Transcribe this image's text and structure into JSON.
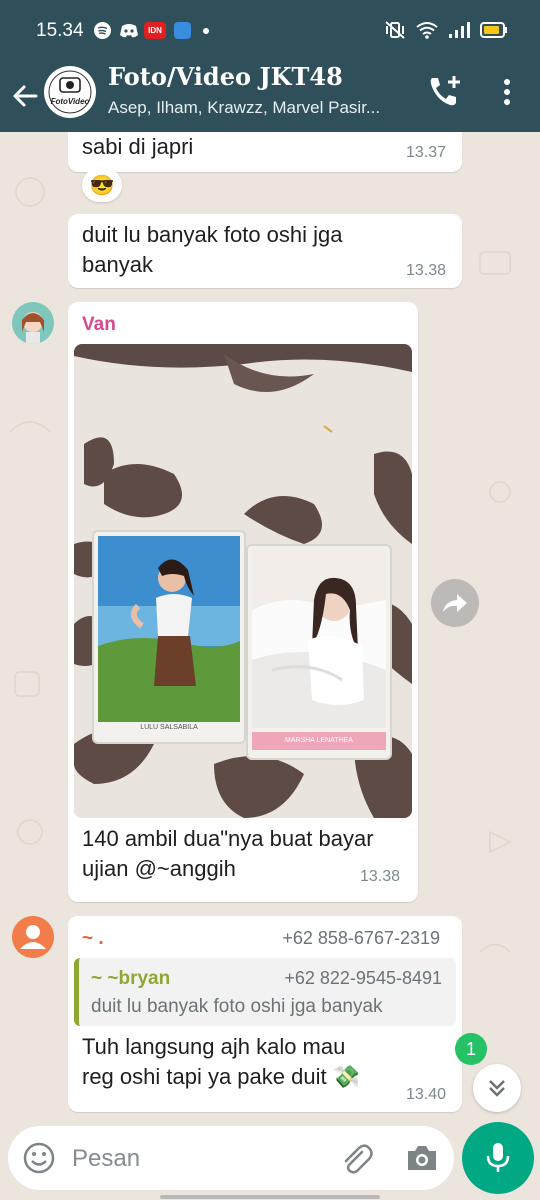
{
  "status_bar": {
    "time": "15.34",
    "app_icons": [
      "spotify-icon",
      "discord-icon",
      "idn-icon",
      "app-icon"
    ],
    "idn_label": "IDN"
  },
  "header": {
    "title": "Foto/Video JKT48",
    "subtitle": "Asep, Ilham, Krawzz, Marvel Pasir...",
    "avatar_text": "FotoVideo",
    "colors": {
      "bar": "#2f4f5a"
    }
  },
  "messages": [
    {
      "text": "sabi di japri",
      "time": "13.37",
      "reaction": "😎"
    },
    {
      "text": "duit lu banyak foto oshi jga banyak",
      "time": "13.38"
    },
    {
      "sender": "Van",
      "sender_color": "#d8488f",
      "image_cards": [
        "LULU SALSABILA",
        "MARSHA LENATHEA"
      ],
      "text": "140 ambil dua\"nya buat bayar ujian @~anggih",
      "time": "13.38"
    },
    {
      "sender": "~ .",
      "sender_color": "#e8622d",
      "phone": "+62 858-6767-2319",
      "quote": {
        "sender": "~ ~bryan",
        "sender_color": "#8ea832",
        "phone": "+62 822-9545-8491",
        "text": "duit lu banyak foto oshi jga banyak"
      },
      "text": "Tuh langsung ajh kalo mau reg oshi tapi ya pake duit",
      "emoji": "💸",
      "time": "13.40"
    }
  ],
  "unread_count": "1",
  "input": {
    "placeholder": "Pesan"
  },
  "colors": {
    "mic": "#00a884",
    "badge": "#25c165",
    "chat_bg": "#ece5dd"
  }
}
